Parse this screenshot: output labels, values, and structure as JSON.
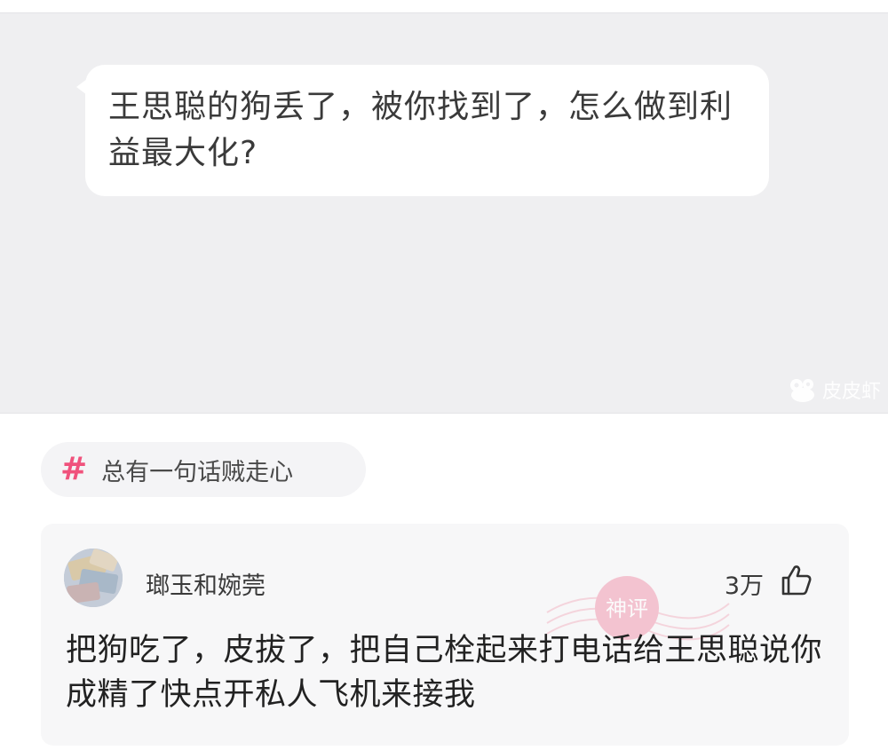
{
  "post": {
    "bubble_text": "王思聪的狗丢了，被你找到了，怎么做到利益最大化?",
    "watermark": "皮皮虾"
  },
  "topic": {
    "icon": "hash-icon",
    "label": "总有一句话贼走心"
  },
  "comment": {
    "username": "瑯玉和婉莞",
    "likes": "3万",
    "stamp_text": "神评",
    "text": "把狗吃了，皮拔了，把自己栓起来打电话给王思聪说你成精了快点开私人飞机来接我"
  },
  "colors": {
    "accent": "#f0527c",
    "panel_bg": "#efeff1",
    "card_bg": "#f7f7f8"
  }
}
